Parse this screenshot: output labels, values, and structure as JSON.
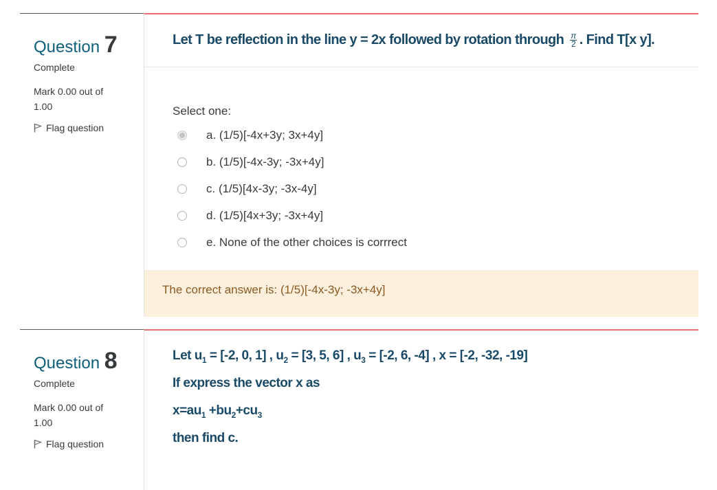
{
  "questions": [
    {
      "label": "Question",
      "number": "7",
      "state": "Complete",
      "grade": "Mark 0.00 out of 1.00",
      "flag_label": "Flag question",
      "text_before": "Let T be reflection in the line y = 2x followed by rotation through",
      "frac_num": "π",
      "frac_den": "2",
      "text_after": ". Find T[x y].",
      "prompt": "Select one:",
      "options": [
        {
          "label": "a. (1/5)[-4x+3y; 3x+4y]",
          "checked": true
        },
        {
          "label": "b. (1/5)[-4x-3y; -3x+4y]",
          "checked": false
        },
        {
          "label": "c. (1/5)[4x-3y; -3x-4y]",
          "checked": false
        },
        {
          "label": "d. (1/5)[4x+3y; -3x+4y]",
          "checked": false
        },
        {
          "label": "e. None of the other choices is corrrect",
          "checked": false
        }
      ],
      "feedback": "The correct answer is: (1/5)[-4x-3y; -3x+4y]"
    },
    {
      "label": "Question",
      "number": "8",
      "state": "Complete",
      "grade": "Mark 0.00 out of 1.00",
      "flag_label": "Flag question",
      "line1": {
        "let": "Let u",
        "s1": "1",
        "v1": " = [-2, 0, 1] , u",
        "s2": "2",
        "v2": " = [3, 5, 6] , u",
        "s3": "3",
        "v3": " = [-2, 6, -4] , x = [-2, -32, -19]"
      },
      "line2": "If express the vector x as",
      "line3": {
        "a": "x=au",
        "s1": "1",
        "b": " +bu",
        "s2": "2",
        "c": "+cu",
        "s3": "3"
      },
      "line4": "then find c."
    }
  ],
  "colors": {
    "title": "#0f5e7a",
    "question_text": "#1a4a67",
    "accent_border": "#ef6b72",
    "feedback_bg": "#fcefdc",
    "feedback_text": "#8a5a22"
  }
}
